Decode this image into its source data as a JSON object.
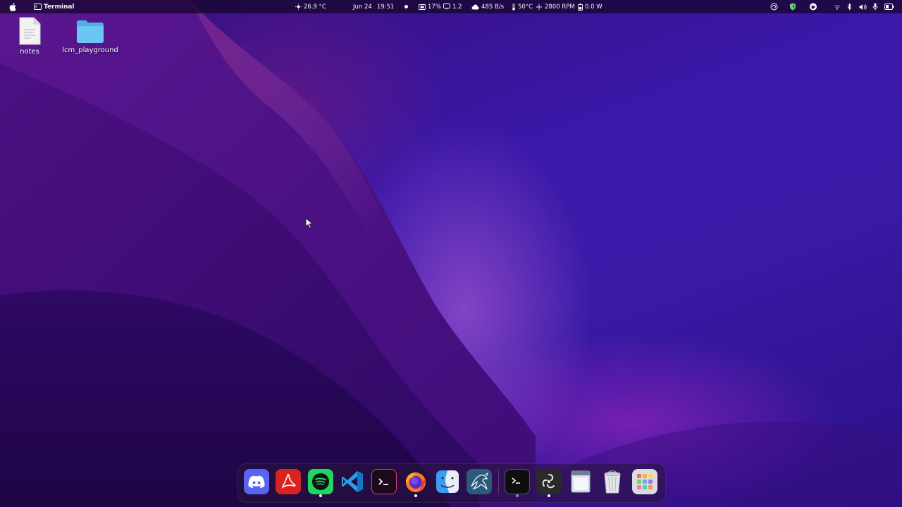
{
  "topbar": {
    "active_app": "Terminal",
    "weather": "26.9 °C",
    "date": "Jun 24",
    "time": "19:51",
    "cpu": "17%",
    "load": "1.2",
    "network": "485 B/s",
    "temperature": "50°C",
    "fan": "2800 RPM",
    "power": "0.0 W"
  },
  "desktop": {
    "icons": [
      {
        "label": "notes",
        "icon": "text-file-icon"
      },
      {
        "label": "lcm_playground",
        "icon": "folder-icon"
      }
    ]
  },
  "dock": {
    "apps": [
      {
        "name": "Discord",
        "icon": "discord-icon",
        "running": false
      },
      {
        "name": "Adobe Acrobat",
        "icon": "acrobat-icon",
        "running": false
      },
      {
        "name": "Spotify",
        "icon": "spotify-icon",
        "running": true
      },
      {
        "name": "Visual Studio Code",
        "icon": "vscode-icon",
        "running": false
      },
      {
        "name": "Terminal (Hyper)",
        "icon": "terminal-pink-icon",
        "running": false
      },
      {
        "name": "Firefox",
        "icon": "firefox-icon",
        "running": true
      },
      {
        "name": "Finder",
        "icon": "finder-icon",
        "running": false
      },
      {
        "name": "MySQL Workbench",
        "icon": "mysql-workbench-icon",
        "running": false
      },
      {
        "name": "Terminal",
        "icon": "terminal-icon",
        "running": true
      },
      {
        "name": "OBS Studio",
        "icon": "obs-icon",
        "running": true
      },
      {
        "name": "Window Switcher",
        "icon": "window-icon",
        "running": false
      },
      {
        "name": "Trash",
        "icon": "trash-icon",
        "running": false
      },
      {
        "name": "App Launcher",
        "icon": "app-grid-icon",
        "running": false
      }
    ]
  },
  "colors": {
    "accent_running_dot": "#ffffff",
    "terminal_dot": "#5aa0ff"
  }
}
